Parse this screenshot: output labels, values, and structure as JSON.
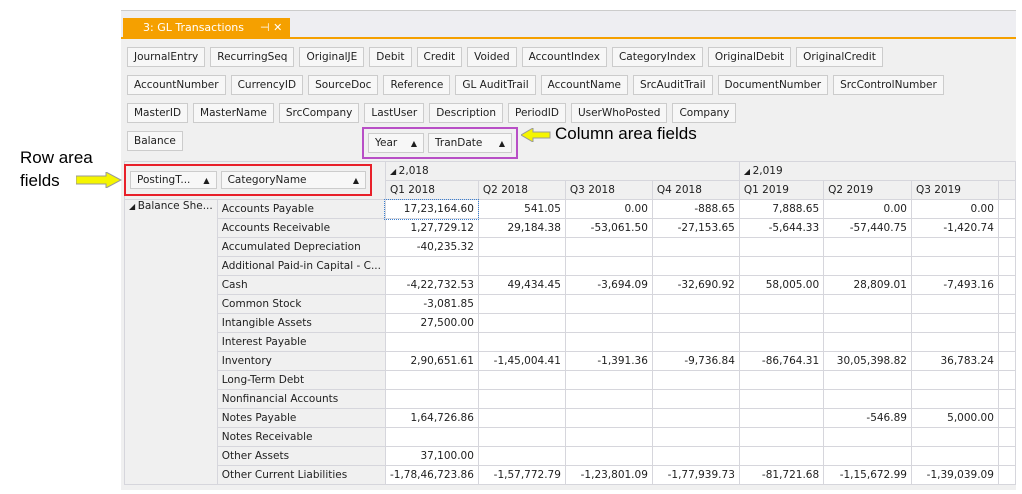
{
  "window": {
    "tab_title": "3: GL Transactions",
    "pin_icon": "pin-icon",
    "close_icon": "close-icon"
  },
  "filter_fields": [
    [
      "JournalEntry",
      "RecurringSeq",
      "OriginalJE",
      "Debit",
      "Credit",
      "Voided",
      "AccountIndex",
      "CategoryIndex",
      "OriginalDebit",
      "OriginalCredit"
    ],
    [
      "AccountNumber",
      "CurrencyID",
      "SourceDoc",
      "Reference",
      "GL AuditTrail",
      "AccountName",
      "SrcAuditTrail",
      "DocumentNumber",
      "SrcControlNumber"
    ],
    [
      "MasterID",
      "MasterName",
      "SrcCompany",
      "LastUser",
      "Description",
      "PeriodID",
      "UserWhoPosted",
      "Company"
    ],
    [
      "Balance"
    ]
  ],
  "column_fields": [
    "Year",
    "TranDate"
  ],
  "row_fields": [
    "PostingT...",
    "CategoryName"
  ],
  "annotations": {
    "column_area": "Column area fields",
    "row_area_line1": "Row area",
    "row_area_line2": "fields",
    "color_column": "#b84fc6",
    "color_row": "#e8202a",
    "arrow_color": "#f5f500"
  },
  "grid": {
    "years": [
      "2,018",
      "2,019"
    ],
    "columns": [
      "Q1 2018",
      "Q2 2018",
      "Q3 2018",
      "Q4 2018",
      "Q1 2019",
      "Q2 2019",
      "Q3 2019"
    ],
    "group": "Balance She...",
    "rows": [
      {
        "name": "Accounts Payable",
        "values": [
          "17,23,164.60",
          "541.05",
          "0.00",
          "-888.65",
          "7,888.65",
          "0.00",
          "0.00"
        ]
      },
      {
        "name": "Accounts Receivable",
        "values": [
          "1,27,729.12",
          "29,184.38",
          "-53,061.50",
          "-27,153.65",
          "-5,644.33",
          "-57,440.75",
          "-1,420.74"
        ]
      },
      {
        "name": "Accumulated Depreciation",
        "values": [
          "-40,235.32",
          "",
          "",
          "",
          "",
          "",
          ""
        ]
      },
      {
        "name": "Additional Paid-in Capital - C...",
        "values": [
          "",
          "",
          "",
          "",
          "",
          "",
          ""
        ]
      },
      {
        "name": "Cash",
        "values": [
          "-4,22,732.53",
          "49,434.45",
          "-3,694.09",
          "-32,690.92",
          "58,005.00",
          "28,809.01",
          "-7,493.16"
        ]
      },
      {
        "name": "Common Stock",
        "values": [
          "-3,081.85",
          "",
          "",
          "",
          "",
          "",
          ""
        ]
      },
      {
        "name": "Intangible Assets",
        "values": [
          "27,500.00",
          "",
          "",
          "",
          "",
          "",
          ""
        ]
      },
      {
        "name": "Interest Payable",
        "values": [
          "",
          "",
          "",
          "",
          "",
          "",
          ""
        ]
      },
      {
        "name": "Inventory",
        "values": [
          "2,90,651.61",
          "-1,45,004.41",
          "-1,391.36",
          "-9,736.84",
          "-86,764.31",
          "30,05,398.82",
          "36,783.24"
        ]
      },
      {
        "name": "Long-Term Debt",
        "values": [
          "",
          "",
          "",
          "",
          "",
          "",
          ""
        ]
      },
      {
        "name": "Nonfinancial Accounts",
        "values": [
          "",
          "",
          "",
          "",
          "",
          "",
          ""
        ]
      },
      {
        "name": "Notes Payable",
        "values": [
          "1,64,726.86",
          "",
          "",
          "",
          "",
          "-546.89",
          "5,000.00"
        ]
      },
      {
        "name": "Notes Receivable",
        "values": [
          "",
          "",
          "",
          "",
          "",
          "",
          ""
        ]
      },
      {
        "name": "Other Assets",
        "values": [
          "37,100.00",
          "",
          "",
          "",
          "",
          "",
          ""
        ]
      },
      {
        "name": "Other Current Liabilities",
        "values": [
          "-1,78,46,723.86",
          "-1,57,772.79",
          "-1,23,801.09",
          "-1,77,939.73",
          "-81,721.68",
          "-1,15,672.99",
          "-1,39,039.09"
        ]
      }
    ]
  }
}
